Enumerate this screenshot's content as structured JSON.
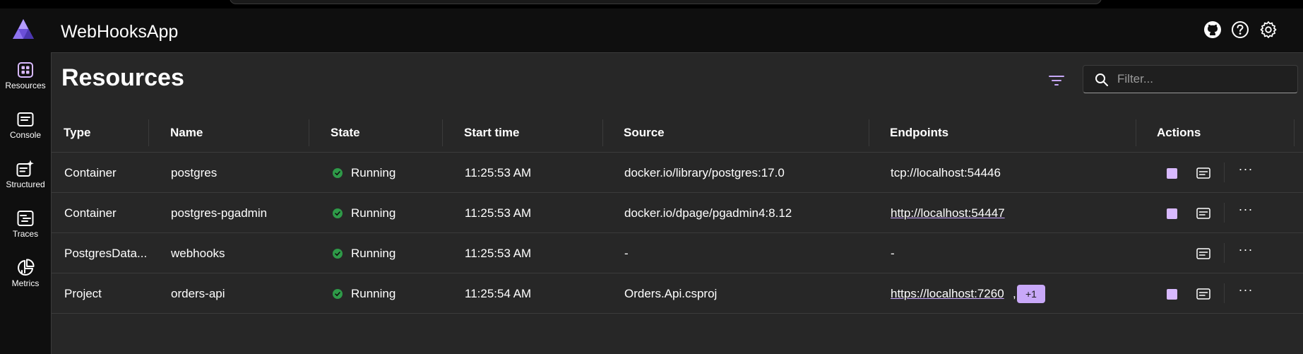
{
  "app": {
    "title": "WebHooksApp"
  },
  "topbar": {
    "icons": [
      "github-icon",
      "help-icon",
      "settings-icon"
    ]
  },
  "sidebar": {
    "items": [
      {
        "label": "Resources",
        "icon": "resources-icon",
        "active": true
      },
      {
        "label": "Console",
        "icon": "console-icon"
      },
      {
        "label": "Structured",
        "icon": "structured-icon"
      },
      {
        "label": "Traces",
        "icon": "traces-icon"
      },
      {
        "label": "Metrics",
        "icon": "metrics-icon"
      }
    ]
  },
  "page": {
    "title": "Resources"
  },
  "search": {
    "placeholder": "Filter...",
    "value": ""
  },
  "table": {
    "headers": [
      "Type",
      "Name",
      "State",
      "Start time",
      "Source",
      "Endpoints",
      "Actions"
    ],
    "rows": [
      {
        "type": "Container",
        "name": "postgres",
        "state": "Running",
        "start_time": "11:25:53 AM",
        "source": "docker.io/library/postgres:17.0",
        "endpoint": "tcp://localhost:54446",
        "endpoint_is_link": false,
        "extra": "",
        "has_stop": true
      },
      {
        "type": "Container",
        "name": "postgres-pgadmin",
        "state": "Running",
        "start_time": "11:25:53 AM",
        "source": "docker.io/dpage/pgadmin4:8.12",
        "endpoint": "http://localhost:54447",
        "endpoint_is_link": true,
        "extra": "",
        "has_stop": true
      },
      {
        "type": "PostgresData...",
        "name": "webhooks",
        "state": "Running",
        "start_time": "11:25:53 AM",
        "source": "-",
        "endpoint": "-",
        "endpoint_is_link": false,
        "extra": "",
        "has_stop": false
      },
      {
        "type": "Project",
        "name": "orders-api",
        "state": "Running",
        "start_time": "11:25:54 AM",
        "source": "Orders.Api.csproj",
        "endpoint": "https://localhost:7260",
        "endpoint_is_link": true,
        "endpoint_suffix": ",",
        "extra": "+1",
        "has_stop": true
      }
    ]
  },
  "colors": {
    "accent": "#c8a8f8",
    "running": "#2e9a48",
    "background": "#272727",
    "sidebar": "#0f0f0f"
  }
}
